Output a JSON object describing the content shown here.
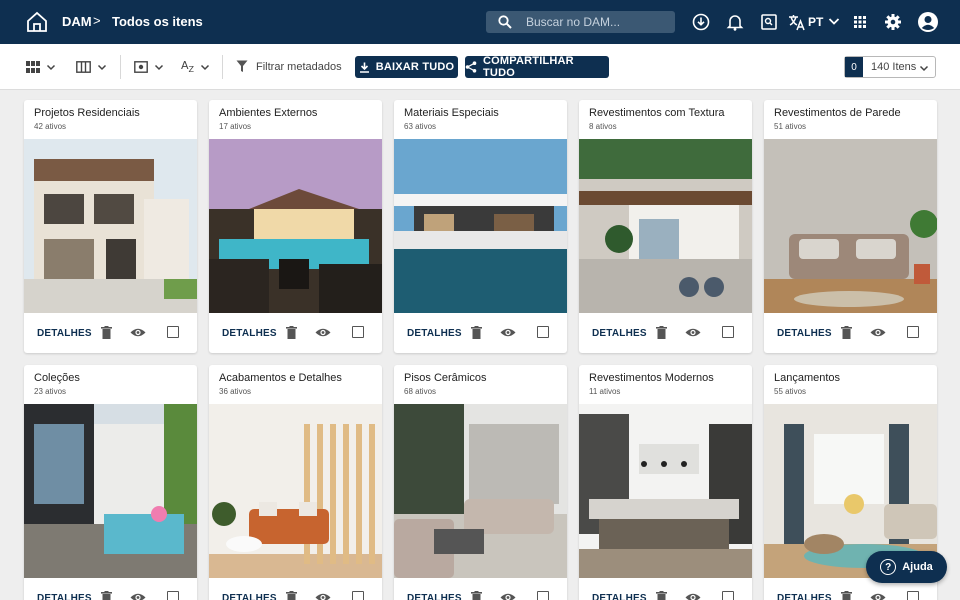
{
  "header": {
    "home_icon": "home-icon",
    "breadcrumb_root": "DAM",
    "breadcrumb_sep": ">",
    "breadcrumb_current": "Todos os itens",
    "search_placeholder": "Buscar no DAM...",
    "language": "PT",
    "icons": [
      "download-circle-icon",
      "bell-icon",
      "image-search-icon",
      "translate-icon",
      "apps-grid-icon",
      "gear-icon",
      "account-icon"
    ]
  },
  "toolbar": {
    "icons": [
      "grid-view-icon",
      "columns-icon",
      "preview-icon",
      "sort-az-icon",
      "filter-icon"
    ],
    "sort_label": "A̷Z",
    "filter_label": "Filtrar metadados",
    "download_all": "BAIXAR TUDO",
    "share_all": "COMPARTILHAR TUDO",
    "count_number": "0",
    "count_label": "140 Itens"
  },
  "card_actions": {
    "details": "DETALHES"
  },
  "cards": [
    {
      "title": "Projetos Residenciais",
      "count": "42 ativos"
    },
    {
      "title": "Ambientes Externos",
      "count": "17 ativos"
    },
    {
      "title": "Materiais Especiais",
      "count": "63 ativos"
    },
    {
      "title": "Revestimentos com Textura",
      "count": "8 ativos"
    },
    {
      "title": "Revestimentos de Parede",
      "count": "51 ativos"
    },
    {
      "title": "Coleções",
      "count": "23 ativos"
    },
    {
      "title": "Acabamentos e Detalhes",
      "count": "36 ativos"
    },
    {
      "title": "Pisos Cerâmicos",
      "count": "68 ativos"
    },
    {
      "title": "Revestimentos Modernos",
      "count": "11 ativos"
    },
    {
      "title": "Lançamentos",
      "count": "55 ativos"
    }
  ],
  "help": {
    "label": "Ajuda",
    "icon": "help-circle-icon"
  },
  "colors": {
    "brand": "#0e2f50",
    "search_bg": "#3b5873",
    "page_bg": "#eeeeee"
  }
}
